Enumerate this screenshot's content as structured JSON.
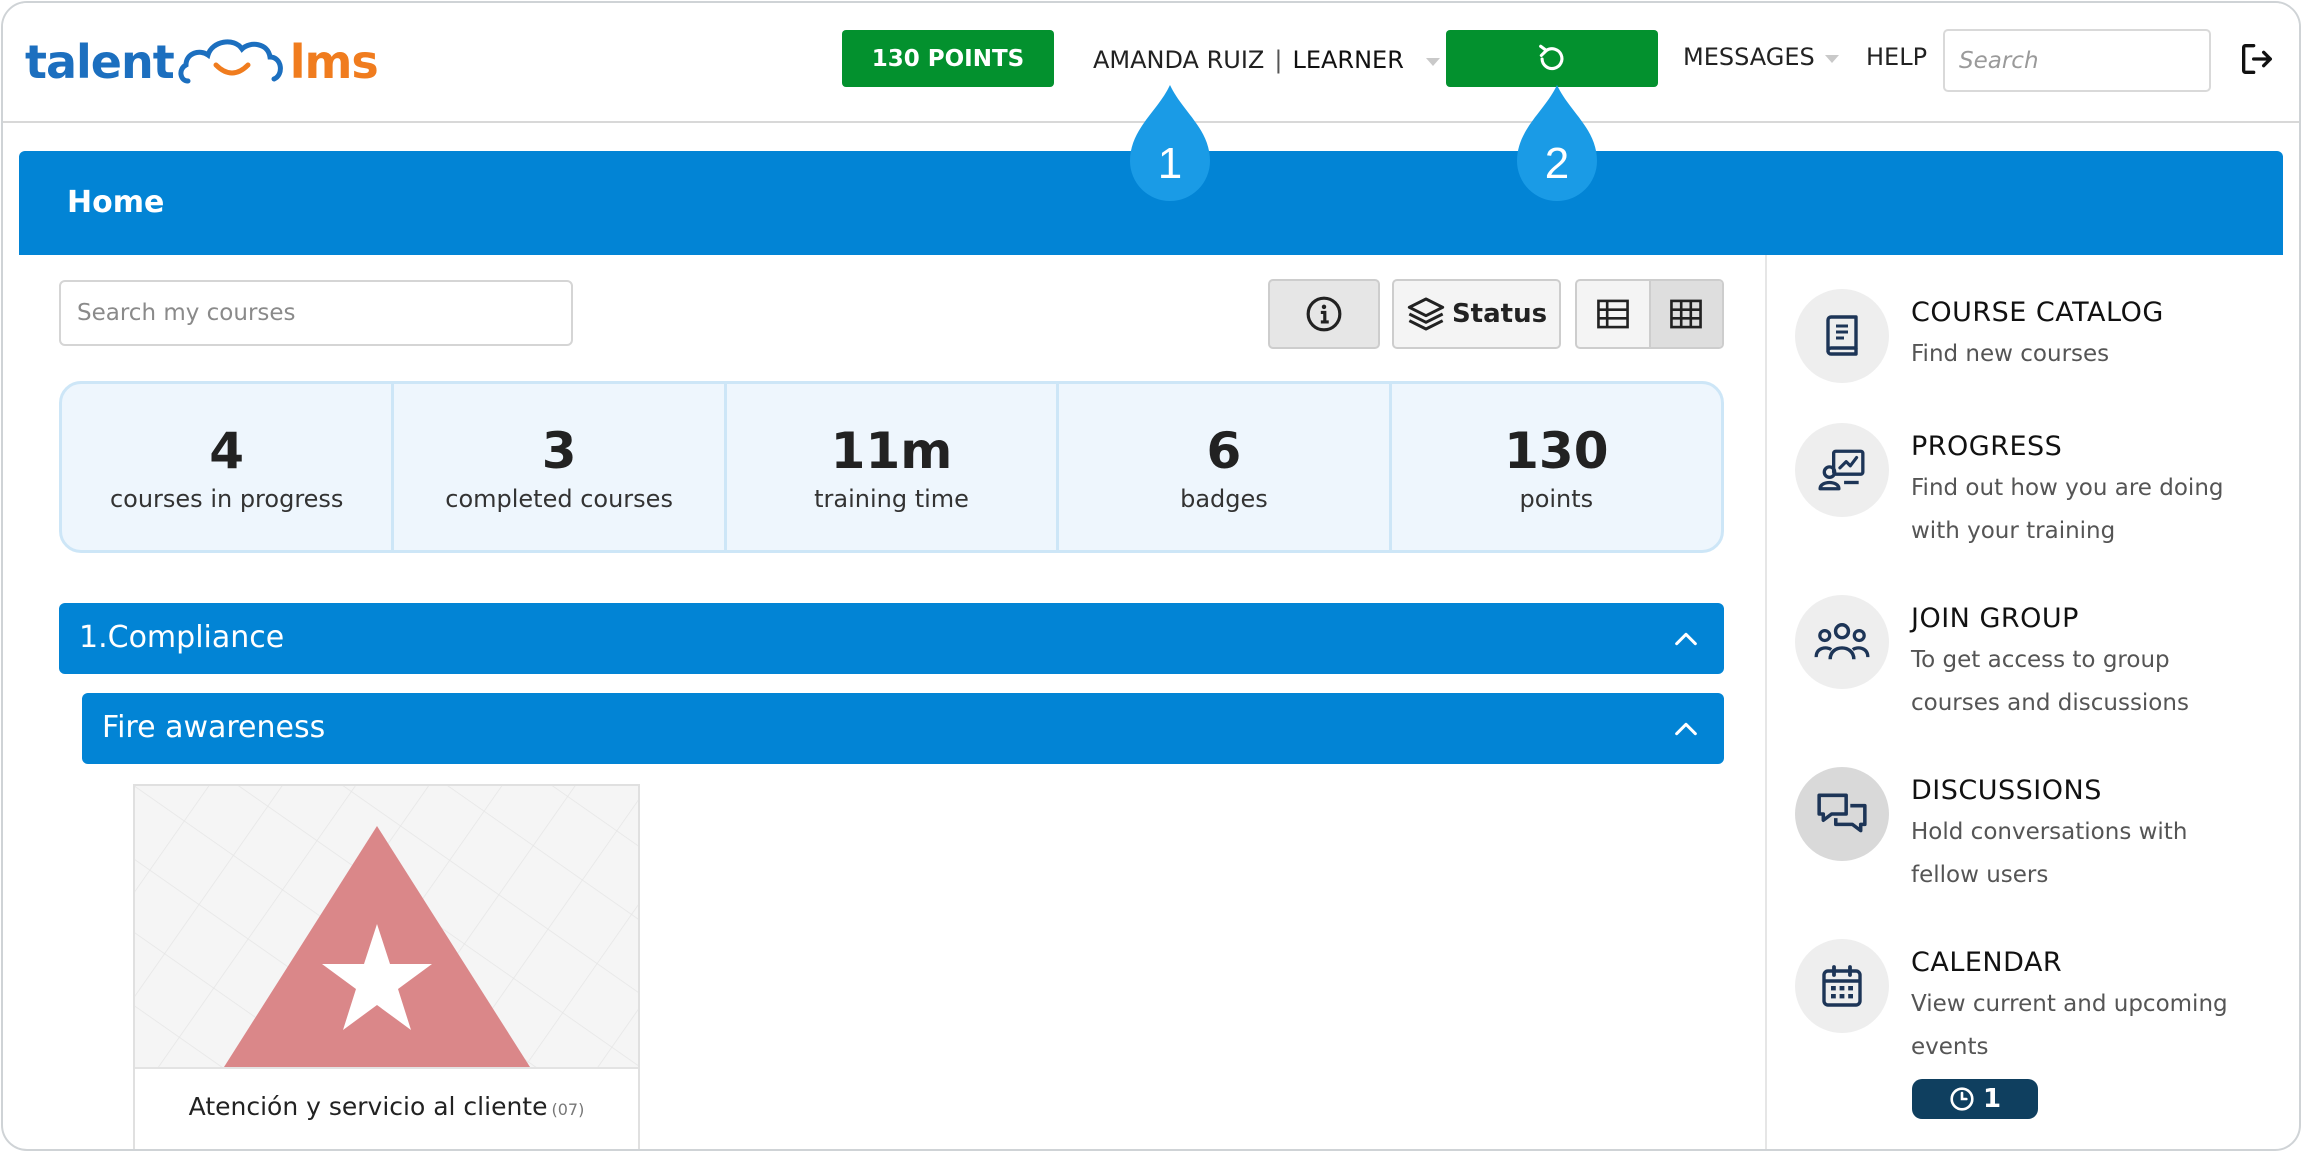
{
  "brand": {
    "part1": "talent",
    "part2": "lms"
  },
  "header": {
    "points": "130 POINTS",
    "user_name": "AMANDA RUIZ",
    "separator": "|",
    "role": "LEARNER",
    "messages": "MESSAGES",
    "help": "HELP",
    "search_placeholder": "Search"
  },
  "callouts": [
    "1",
    "2"
  ],
  "page": {
    "title": "Home"
  },
  "toolbar": {
    "search_placeholder": "Search my courses",
    "status_label": "Status"
  },
  "stats": [
    {
      "value": "4",
      "label": "courses in progress"
    },
    {
      "value": "3",
      "label": "completed courses"
    },
    {
      "value": "11m",
      "label": "training time"
    },
    {
      "value": "6",
      "label": "badges"
    },
    {
      "value": "130",
      "label": "points"
    }
  ],
  "categories": {
    "main": "1.Compliance",
    "sub": "Fire awareness"
  },
  "course": {
    "title": "Atención y servicio al cliente",
    "code": "(07)"
  },
  "sidebar": [
    {
      "title": "COURSE CATALOG",
      "desc": "Find new courses",
      "icon": "book-icon"
    },
    {
      "title": "PROGRESS",
      "desc": "Find out how you are doing with your training",
      "icon": "progress-chart-icon"
    },
    {
      "title": "JOIN GROUP",
      "desc": "To get access to group courses and discussions",
      "icon": "group-icon"
    },
    {
      "title": "DISCUSSIONS",
      "desc": "Hold conversations with fellow users",
      "icon": "chat-bubbles-icon"
    },
    {
      "title": "CALENDAR",
      "desc": "View current and upcoming events",
      "icon": "calendar-icon"
    }
  ],
  "calendar_badge": "1",
  "colors": {
    "primary_blue": "#0284d5",
    "green": "#03912e",
    "callout_blue": "#1a9be6",
    "logo_blue": "#1c6fbf",
    "logo_orange": "#f07c1e"
  }
}
